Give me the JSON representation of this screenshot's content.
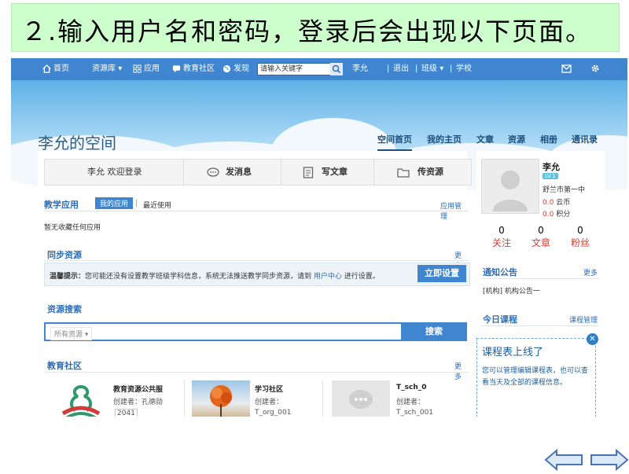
{
  "slide_title": "２.输入用户名和密码，登录后会出现以下页面。",
  "topbar": {
    "home": "首页",
    "resources": "资源库",
    "apps": "应用",
    "community": "教育社区",
    "discover": "发现",
    "search_placeholder": "请输入关键字",
    "user": "李允",
    "logout": "退出",
    "class": "班级",
    "school": "学校"
  },
  "banner": {
    "space_title": "李允的空间",
    "nav": [
      "空间首页",
      "我的主页",
      "文章",
      "资源",
      "相册",
      "通讯录"
    ]
  },
  "actions": {
    "welcome": "李允 欢迎登录",
    "send_message": "发消息",
    "write_article": "写文章",
    "upload_resource": "传资源"
  },
  "teaching_apps": {
    "title": "教学应用",
    "tab_mine": "我的应用",
    "tab_recent": "最近使用",
    "manage": "应用管理",
    "empty": "暂无收藏任何应用"
  },
  "sync_resources": {
    "title": "同步资源",
    "more": "更多",
    "tip_label": "温馨提示：",
    "tip_text": "您可能还没有设置教学班级学科信息，系统无法推送教学同步资源，请到",
    "tip_link": "用户中心",
    "tip_end": "进行设置。",
    "setup_button": "立即设置"
  },
  "resource_search": {
    "title": "资源搜索",
    "filter": "所有资源",
    "button": "搜索"
  },
  "edu_community": {
    "title": "教育社区",
    "more": "更多",
    "cards": [
      {
        "name": "教育资源公共服",
        "creator": "创建者：孔德勋",
        "extra": "2041"
      },
      {
        "name": "学习社区",
        "creator": "创建者：",
        "extra": "T_org_001"
      },
      {
        "name": "T_sch_0",
        "creator": "创建者：",
        "extra": "T_sch_001"
      }
    ]
  },
  "profile": {
    "name": "李允",
    "level": "LV.1",
    "school": "舒兰市第一中",
    "cloud_coins_value": "0.0",
    "cloud_coins_label": "云币",
    "points_value": "0.0",
    "points_label": "积分",
    "stats": [
      {
        "value": "0",
        "label": "关注"
      },
      {
        "value": "0",
        "label": "文章"
      },
      {
        "value": "0",
        "label": "粉丝"
      }
    ]
  },
  "notice": {
    "title": "通知公告",
    "more": "更多",
    "item": "[机构] 机构公告一"
  },
  "today_course": {
    "title": "今日课程",
    "manage": "课程管理",
    "note_title": "课程表上线了",
    "note_text": "您可以管理编辑课程表，也可以查看当天及全部的课程信息。"
  },
  "colors": {
    "topbar": "#3f85cf",
    "slide_title_bg": "#ccffcc",
    "accent_red": "#e03a2f"
  }
}
